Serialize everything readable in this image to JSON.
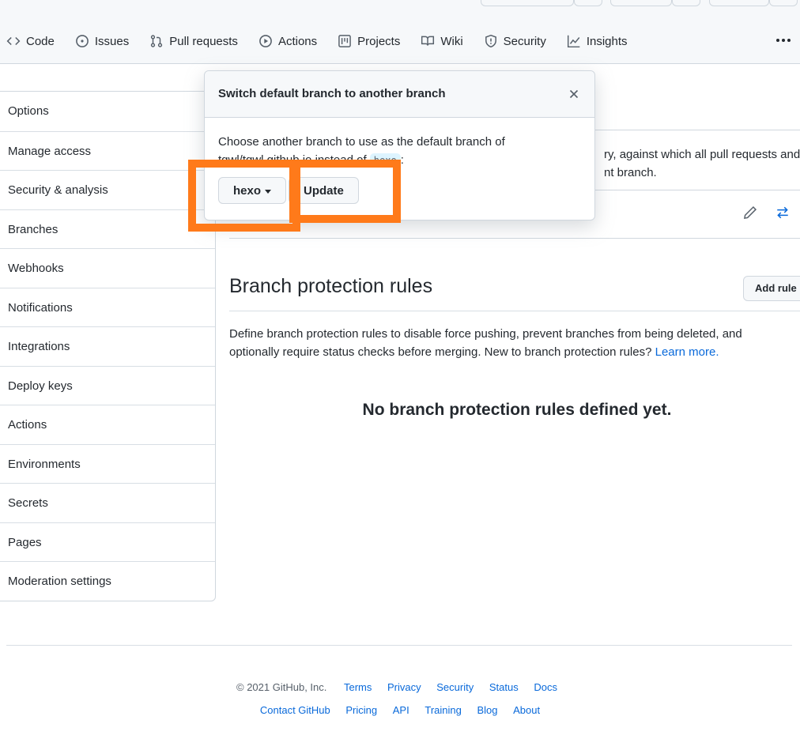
{
  "nav": {
    "tabs": [
      {
        "label": "Code",
        "icon": "code-icon"
      },
      {
        "label": "Issues",
        "icon": "issue-icon"
      },
      {
        "label": "Pull requests",
        "icon": "pull-request-icon"
      },
      {
        "label": "Actions",
        "icon": "play-icon"
      },
      {
        "label": "Projects",
        "icon": "project-icon"
      },
      {
        "label": "Wiki",
        "icon": "book-icon"
      },
      {
        "label": "Security",
        "icon": "shield-icon"
      },
      {
        "label": "Insights",
        "icon": "graph-icon"
      }
    ],
    "more_icon": "kebab-horizontal-icon"
  },
  "sidebar": {
    "items": [
      {
        "label": "Options"
      },
      {
        "label": "Manage access"
      },
      {
        "label": "Security & analysis"
      },
      {
        "label": "Branches"
      },
      {
        "label": "Webhooks"
      },
      {
        "label": "Notifications"
      },
      {
        "label": "Integrations"
      },
      {
        "label": "Deploy keys"
      },
      {
        "label": "Actions"
      },
      {
        "label": "Environments"
      },
      {
        "label": "Secrets"
      },
      {
        "label": "Pages"
      },
      {
        "label": "Moderation settings"
      }
    ]
  },
  "main": {
    "default_desc_line1": "ry, against which all pull requests and",
    "default_desc_line2": "nt branch.",
    "protection": {
      "title": "Branch protection rules",
      "add_rule": "Add rule",
      "desc": "Define branch protection rules to disable force pushing, prevent branches from being deleted, and optionally require status checks before merging. New to branch protection rules?",
      "learn_more": "Learn more.",
      "empty": "No branch protection rules defined yet."
    }
  },
  "modal": {
    "title": "Switch default branch to another branch",
    "body_prefix": "Choose another branch to use as the default branch of",
    "repo": "tqwl/tqwl.github.io",
    "instead_of": "instead of",
    "current_branch": "hexo",
    "colon": ":",
    "branch_select": "hexo",
    "update": "Update"
  },
  "footer": {
    "copyright": "© 2021 GitHub, Inc.",
    "links_row1": [
      "Terms",
      "Privacy",
      "Security",
      "Status",
      "Docs"
    ],
    "links_row2": [
      "Contact GitHub",
      "Pricing",
      "API",
      "Training",
      "Blog",
      "About"
    ]
  },
  "colors": {
    "accent": "#0969da",
    "highlight": "#ff7a1a"
  }
}
